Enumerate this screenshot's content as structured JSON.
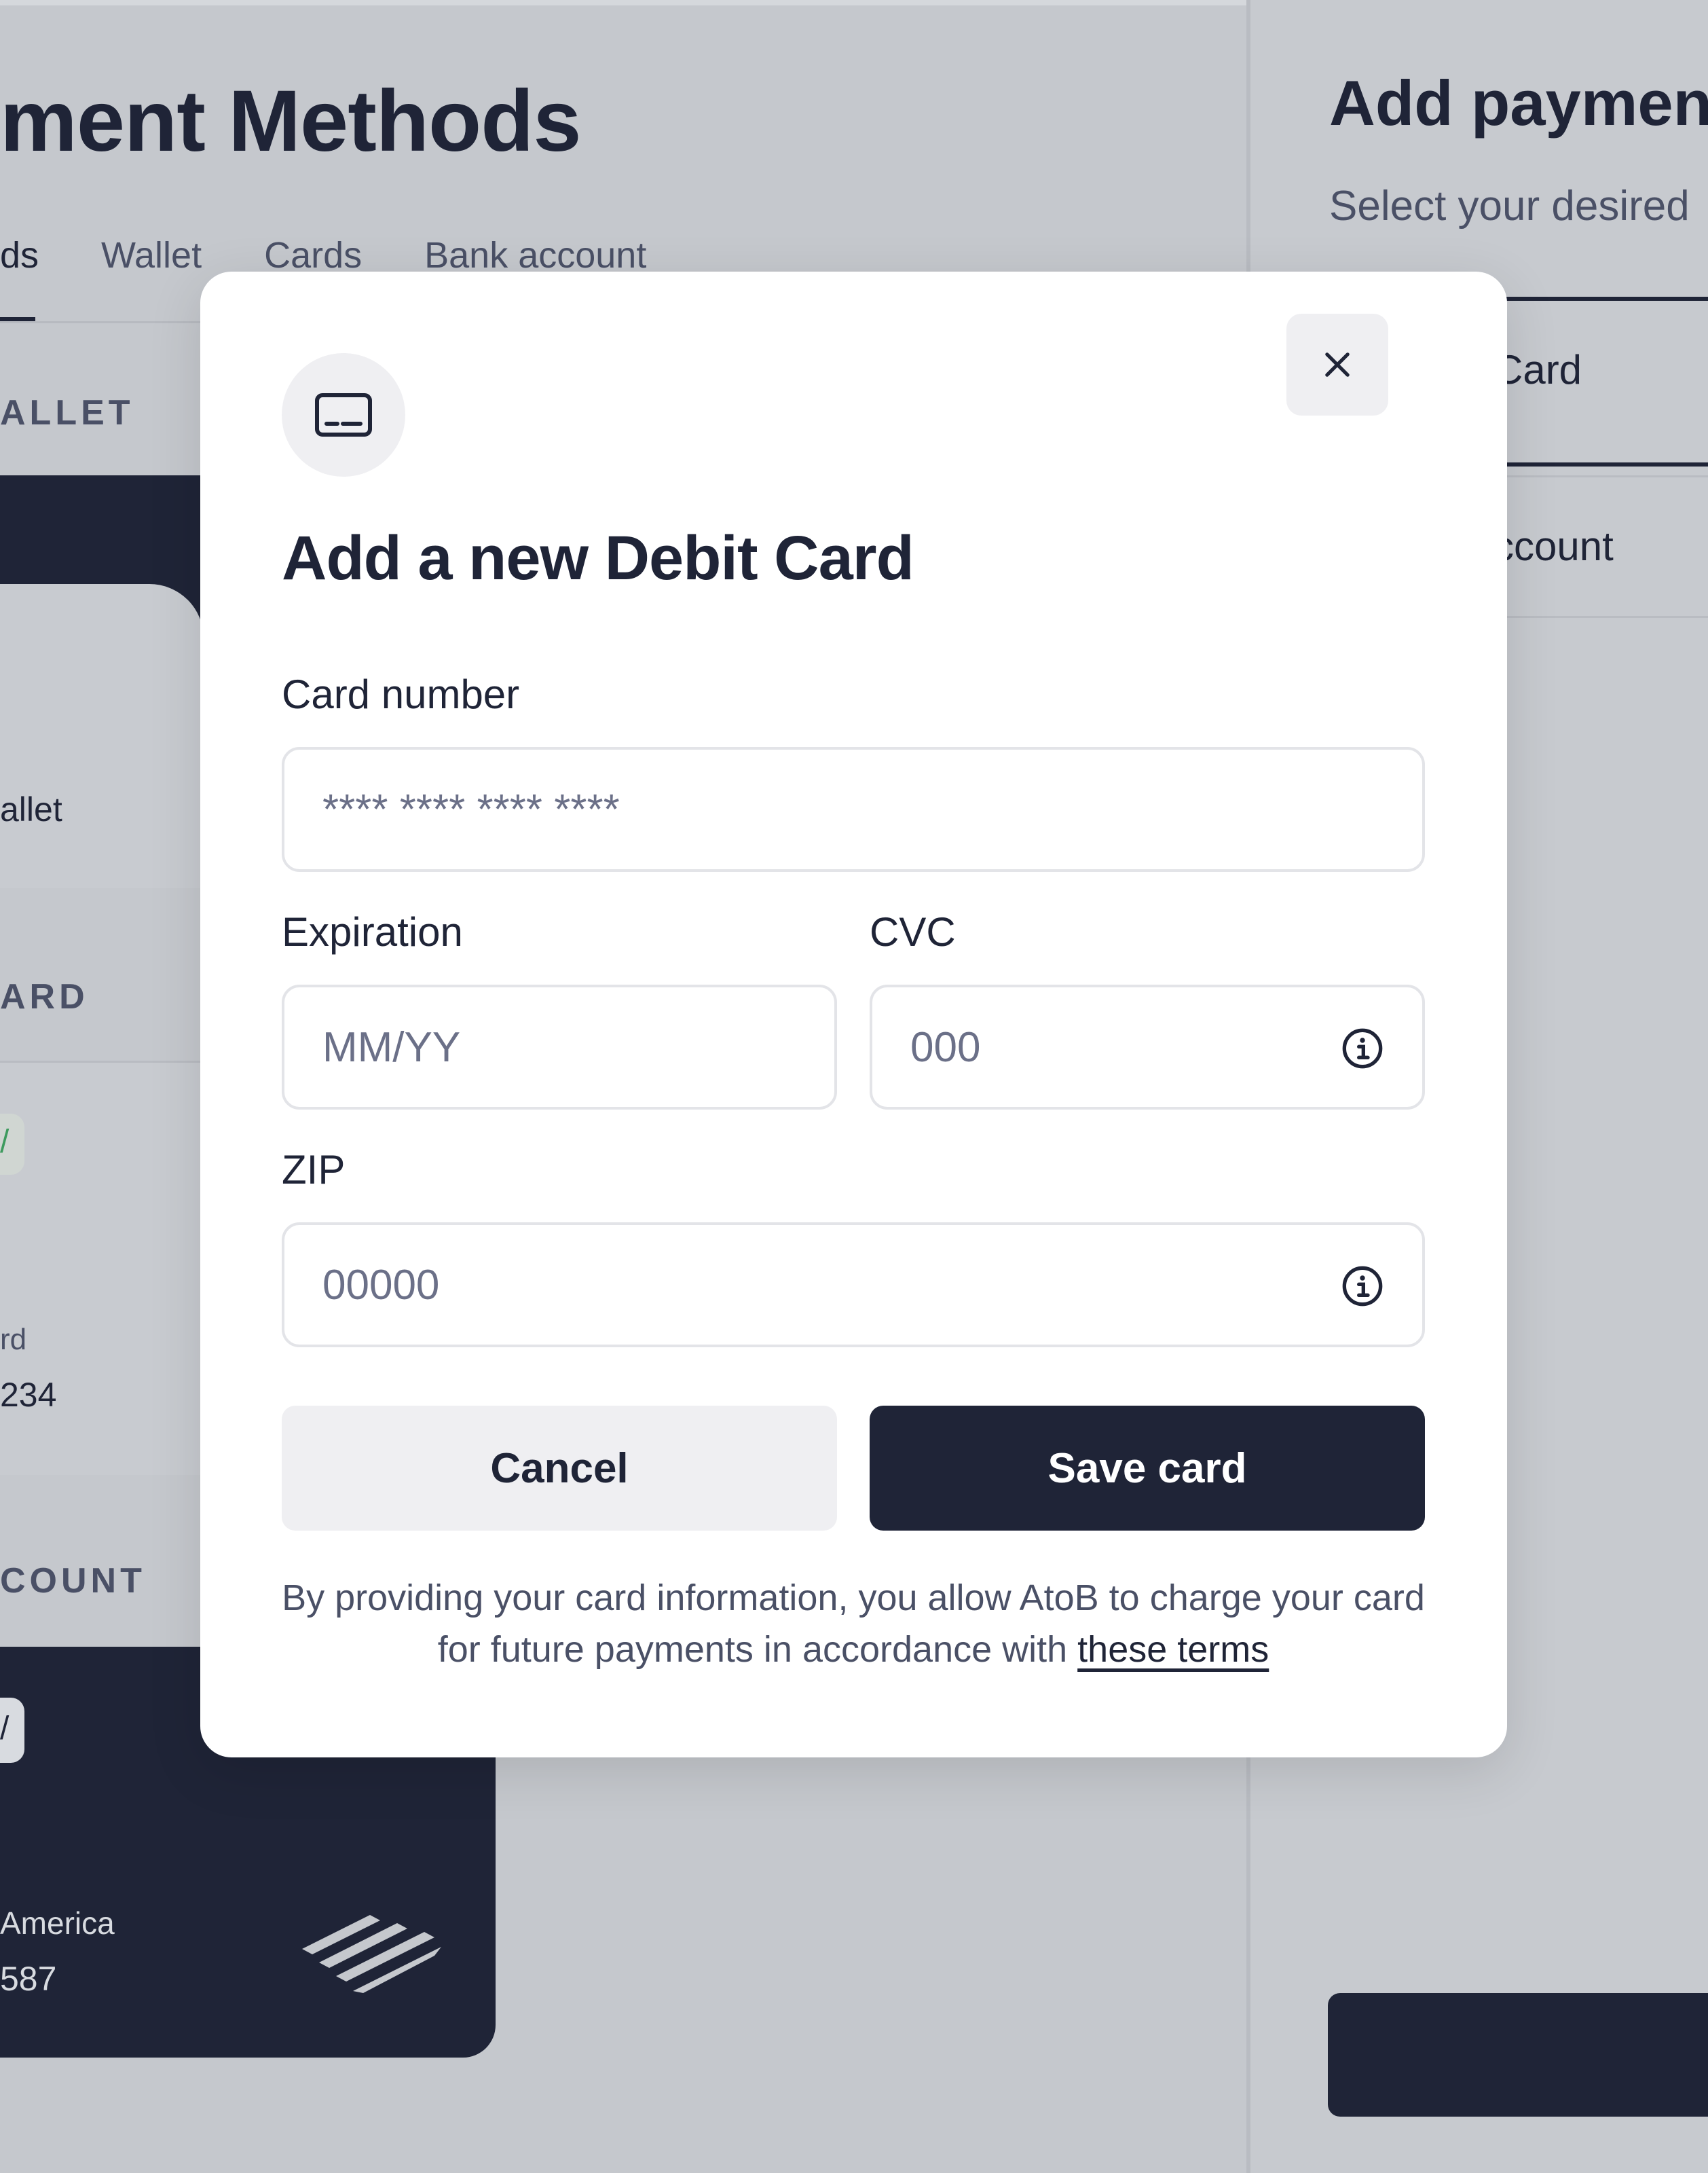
{
  "background": {
    "page_title": "ment Methods",
    "tabs": [
      "ds",
      "Wallet",
      "Cards",
      "Bank account"
    ],
    "sections": {
      "wallet": "ALLET",
      "card": "ARD",
      "account": "COUNT"
    },
    "wallet_label": "allet",
    "card_label": "rd",
    "card_number": "234",
    "card_badge": "/",
    "bank_badge": "/",
    "bank_name": "America",
    "bank_number": "587"
  },
  "right_panel": {
    "title": "Add payment",
    "subtitle": "Select your desired",
    "option_card": "Card",
    "option_account": "ccount"
  },
  "modal": {
    "title": "Add a new Debit Card",
    "card_number": {
      "label": "Card number",
      "placeholder": "**** **** **** ****"
    },
    "expiration": {
      "label": "Expiration",
      "placeholder": "MM/YY"
    },
    "cvc": {
      "label": "CVC",
      "placeholder": "000"
    },
    "zip": {
      "label": "ZIP",
      "placeholder": "00000"
    },
    "cancel_label": "Cancel",
    "save_label": "Save card",
    "disclaimer_text": "By providing your card information, you allow AtoB to charge your card for future payments in accordance with ",
    "terms_link": "these terms"
  },
  "icons": {
    "close": "close-icon",
    "card": "credit-card-icon",
    "info": "info-icon"
  },
  "colors": {
    "primary_dark": "#1f2437",
    "overlay_gray": "#c5c8cd",
    "button_light": "#efeff2",
    "text_muted": "#4a5066"
  }
}
